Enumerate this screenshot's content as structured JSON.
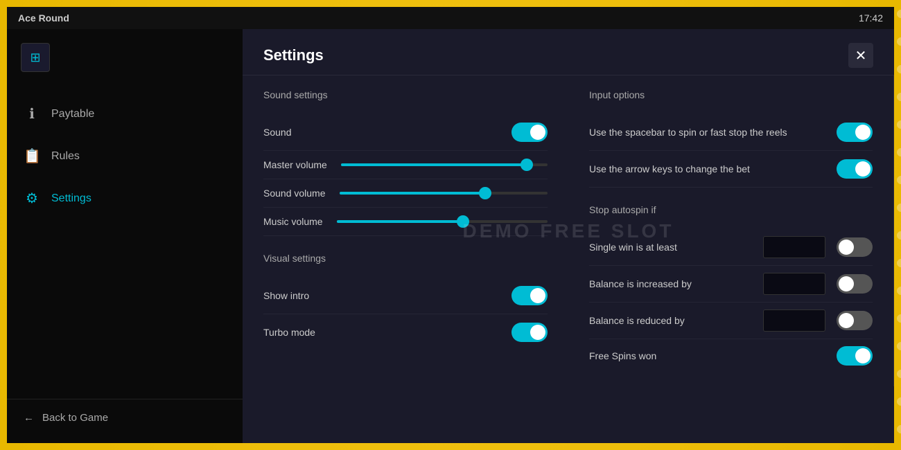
{
  "topbar": {
    "title": "Ace Round",
    "time": "17:42"
  },
  "sidebar": {
    "logo_icon": "⊞",
    "nav_items": [
      {
        "id": "paytable",
        "label": "Paytable",
        "icon": "ℹ",
        "active": false
      },
      {
        "id": "rules",
        "label": "Rules",
        "icon": "📖",
        "active": false
      },
      {
        "id": "settings",
        "label": "Settings",
        "icon": "⚙",
        "active": true
      }
    ],
    "back_label": "Back to Game"
  },
  "settings": {
    "title": "Settings",
    "close_icon": "✕",
    "watermark": "DEMO  FREE SLOT",
    "sound_settings": {
      "section_title": "Sound settings",
      "rows": [
        {
          "id": "sound",
          "label": "Sound",
          "type": "toggle",
          "value": true
        },
        {
          "id": "master-volume",
          "label": "Master volume",
          "type": "slider",
          "fill_pct": 90
        },
        {
          "id": "sound-volume",
          "label": "Sound volume",
          "type": "slider",
          "fill_pct": 70
        },
        {
          "id": "music-volume",
          "label": "Music volume",
          "type": "slider",
          "fill_pct": 60
        }
      ]
    },
    "visual_settings": {
      "section_title": "Visual settings",
      "rows": [
        {
          "id": "show-intro",
          "label": "Show intro",
          "type": "toggle",
          "value": true
        },
        {
          "id": "turbo-mode",
          "label": "Turbo mode",
          "type": "toggle",
          "value": true
        }
      ]
    },
    "input_options": {
      "section_title": "Input options",
      "rows": [
        {
          "id": "spacebar-spin",
          "label": "Use the spacebar to spin or fast stop the reels",
          "type": "toggle",
          "value": true
        },
        {
          "id": "arrow-keys-bet",
          "label": "Use the arrow keys to change the bet",
          "type": "toggle",
          "value": true
        }
      ]
    },
    "stop_autospin": {
      "section_title": "Stop autospin if",
      "rows": [
        {
          "id": "single-win",
          "label": "Single win is at least",
          "type": "input-toggle",
          "value": false
        },
        {
          "id": "balance-increased",
          "label": "Balance is increased by",
          "type": "input-toggle",
          "value": false
        },
        {
          "id": "balance-reduced",
          "label": "Balance is reduced by",
          "type": "input-toggle",
          "value": false
        },
        {
          "id": "free-spins-won",
          "label": "Free Spins won",
          "type": "toggle",
          "value": true
        }
      ]
    }
  }
}
